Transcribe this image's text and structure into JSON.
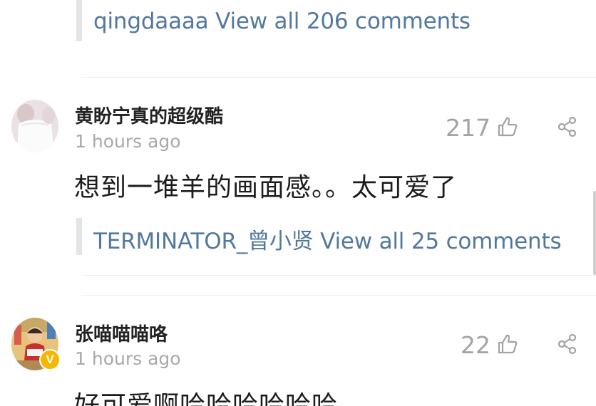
{
  "top_reply": {
    "text": "qingdaaaa View all 206 comments"
  },
  "comments": [
    {
      "username": "黄盼宁真的超级酷",
      "time": "1 hours ago",
      "likes": "217",
      "text": "想到一堆羊的画面感。。太可爱了",
      "reply_link": "TERMINATOR_曾小贤 View all 25 comments"
    },
    {
      "username": "张喵喵喵咯",
      "time": "1 hours ago",
      "likes": "22",
      "text": "好可爱啊哈哈哈哈哈哈",
      "verified_badge": "V"
    }
  ],
  "icons": {
    "like": "thumbs-up-icon",
    "share": "share-icon"
  },
  "colors": {
    "link": "#52799d",
    "username": "#222222",
    "meta": "#a9a9a9",
    "badge": "#f5b800"
  }
}
